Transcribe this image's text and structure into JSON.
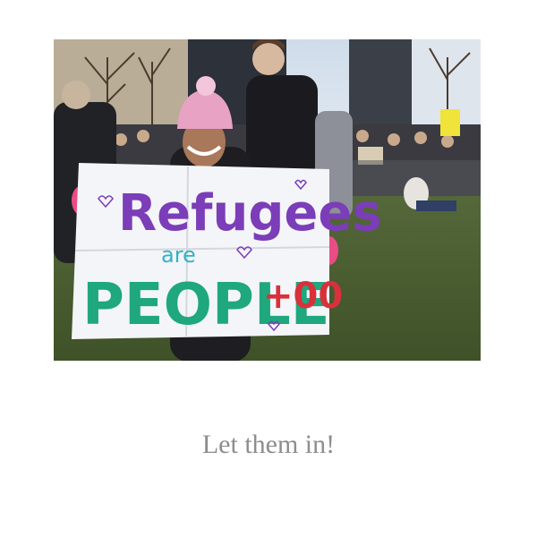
{
  "photo": {
    "sign": {
      "line1": "Refugees",
      "line2": "are",
      "line3": "PEOPLE",
      "line4": "+00"
    }
  },
  "caption": "Let them in!",
  "colors": {
    "caption": "#8d8d8d",
    "purple": "#7b3db8",
    "green": "#1fa77e",
    "red": "#d8313b",
    "teal": "#2fb4c8",
    "hat_pink": "#e8a2c4"
  }
}
